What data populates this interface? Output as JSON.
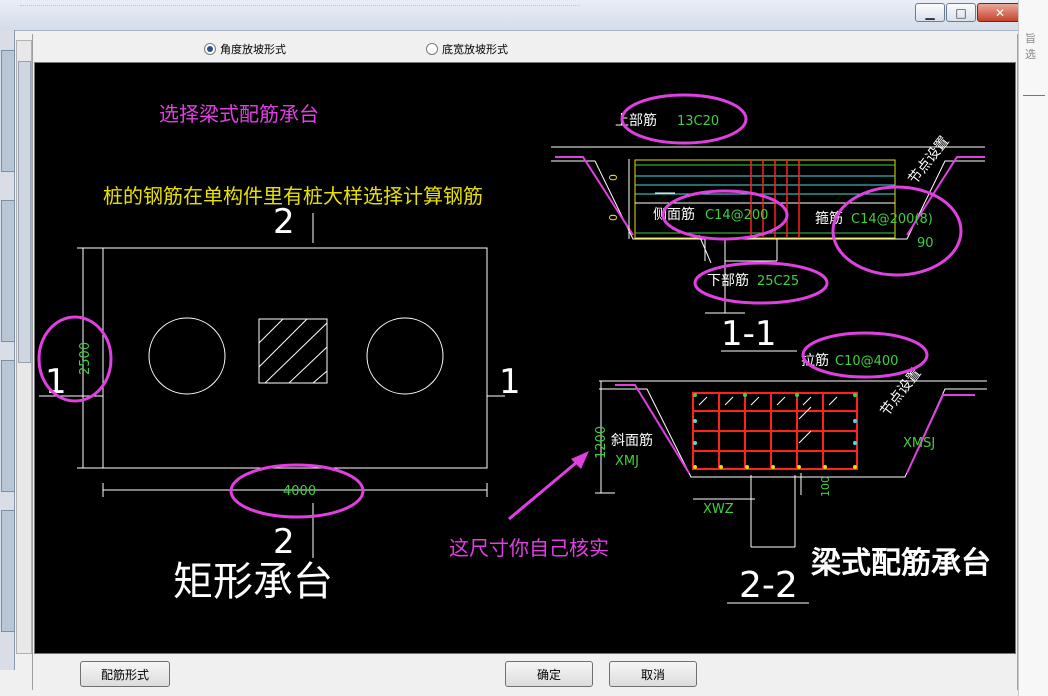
{
  "right_strip_text": "旨 选",
  "radio_options": [
    {
      "label": "角度放坡形式",
      "selected": true
    },
    {
      "label": "底宽放坡形式",
      "selected": false
    }
  ],
  "buttons": {
    "rebar_form": "配筋形式",
    "ok": "确定",
    "cancel": "取消"
  },
  "annotations": {
    "select_beam": "选择梁式配筋承台",
    "pile_note": "桩的钢筋在单构件里有桩大样选择计算钢筋",
    "check_dim": "这尺寸你自己核实",
    "beam_title": "梁式配筋承台"
  },
  "rect_cap": {
    "title": "矩形承台",
    "width_dim": "4000",
    "height_dim": "2500",
    "sec_top": "2",
    "sec_bottom": "2",
    "sec_left": "1",
    "sec_right": "1"
  },
  "section_11": {
    "label": "1-1",
    "top_rebar_label": "上部筋",
    "top_rebar_val": "13C20",
    "side_rebar_label": "侧面筋",
    "side_rebar_val": "C14@200",
    "stirrup_label": "箍筋",
    "stirrup_val": "C14@200(8)",
    "bottom_rebar_label": "下部筋",
    "bottom_rebar_val": "25C25",
    "angle": "90",
    "node_setting": "节点设置",
    "zero": "0"
  },
  "section_22": {
    "label": "2-2",
    "tie_label": "拉筋",
    "tie_val": "C10@400",
    "node_setting": "节点设置",
    "slope_label": "斜面筋",
    "xmj": "XMJ",
    "xmsj": "XMSJ",
    "xwz": "XWZ",
    "height": "1200",
    "dim_100": "100"
  },
  "colors": {
    "magenta": "#e040e0",
    "green": "#40d040",
    "yellow": "#e8e000",
    "red": "#ff2020",
    "cyan": "#40e0e0",
    "white": "#ffffff"
  }
}
